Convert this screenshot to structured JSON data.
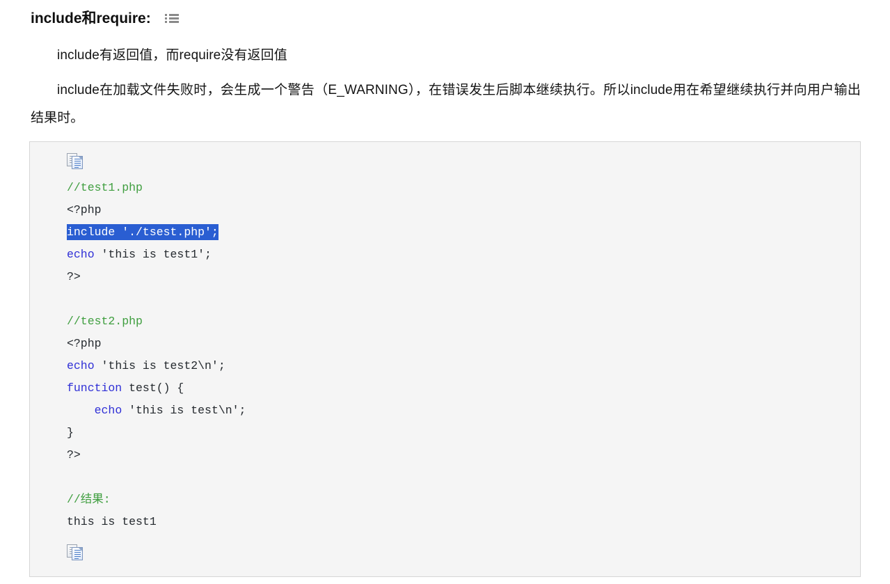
{
  "heading": {
    "title": "include和require:",
    "icon": "list-icon"
  },
  "paragraphs": [
    "include有返回值，而require没有返回值",
    "include在加载文件失败时，会生成一个警告（E_WARNING），在错误发生后脚本继续执行。所以include用在希望继续执行并向用户输出结果时。"
  ],
  "code_block": {
    "copy_icon_top": "copy-icon",
    "copy_icon_bottom": "copy-icon",
    "language": "php",
    "selection_text": "include './tsest.php';",
    "colors": {
      "background": "#f5f5f5",
      "border": "#d6d6d6",
      "comment": "#3f9e3f",
      "keyword": "#2f2fd6",
      "text": "#24292e",
      "selection_bg": "#2a5ed2",
      "selection_fg": "#ffffff"
    },
    "lines": [
      {
        "text": "//test1.php",
        "type": "comment"
      },
      {
        "text": "<?php",
        "type": "plain"
      },
      {
        "text": "include './tsest.php';",
        "type": "selected",
        "keyword": "include"
      },
      {
        "text": "echo 'this is test1';",
        "type": "plain",
        "keyword": "echo"
      },
      {
        "text": "?>",
        "type": "plain"
      },
      {
        "text": "",
        "type": "blank"
      },
      {
        "text": "//test2.php",
        "type": "comment"
      },
      {
        "text": "<?php",
        "type": "plain"
      },
      {
        "text": "echo 'this is test2\\n';",
        "type": "plain",
        "keyword": "echo"
      },
      {
        "text": "function test() {",
        "type": "plain",
        "keyword": "function"
      },
      {
        "text": "    echo 'this is test\\n';",
        "type": "plain",
        "keyword": "echo"
      },
      {
        "text": "}",
        "type": "plain"
      },
      {
        "text": "?>",
        "type": "plain"
      },
      {
        "text": "",
        "type": "blank"
      },
      {
        "text": "//结果:",
        "type": "comment"
      },
      {
        "text": "this is test1",
        "type": "plain"
      }
    ]
  }
}
